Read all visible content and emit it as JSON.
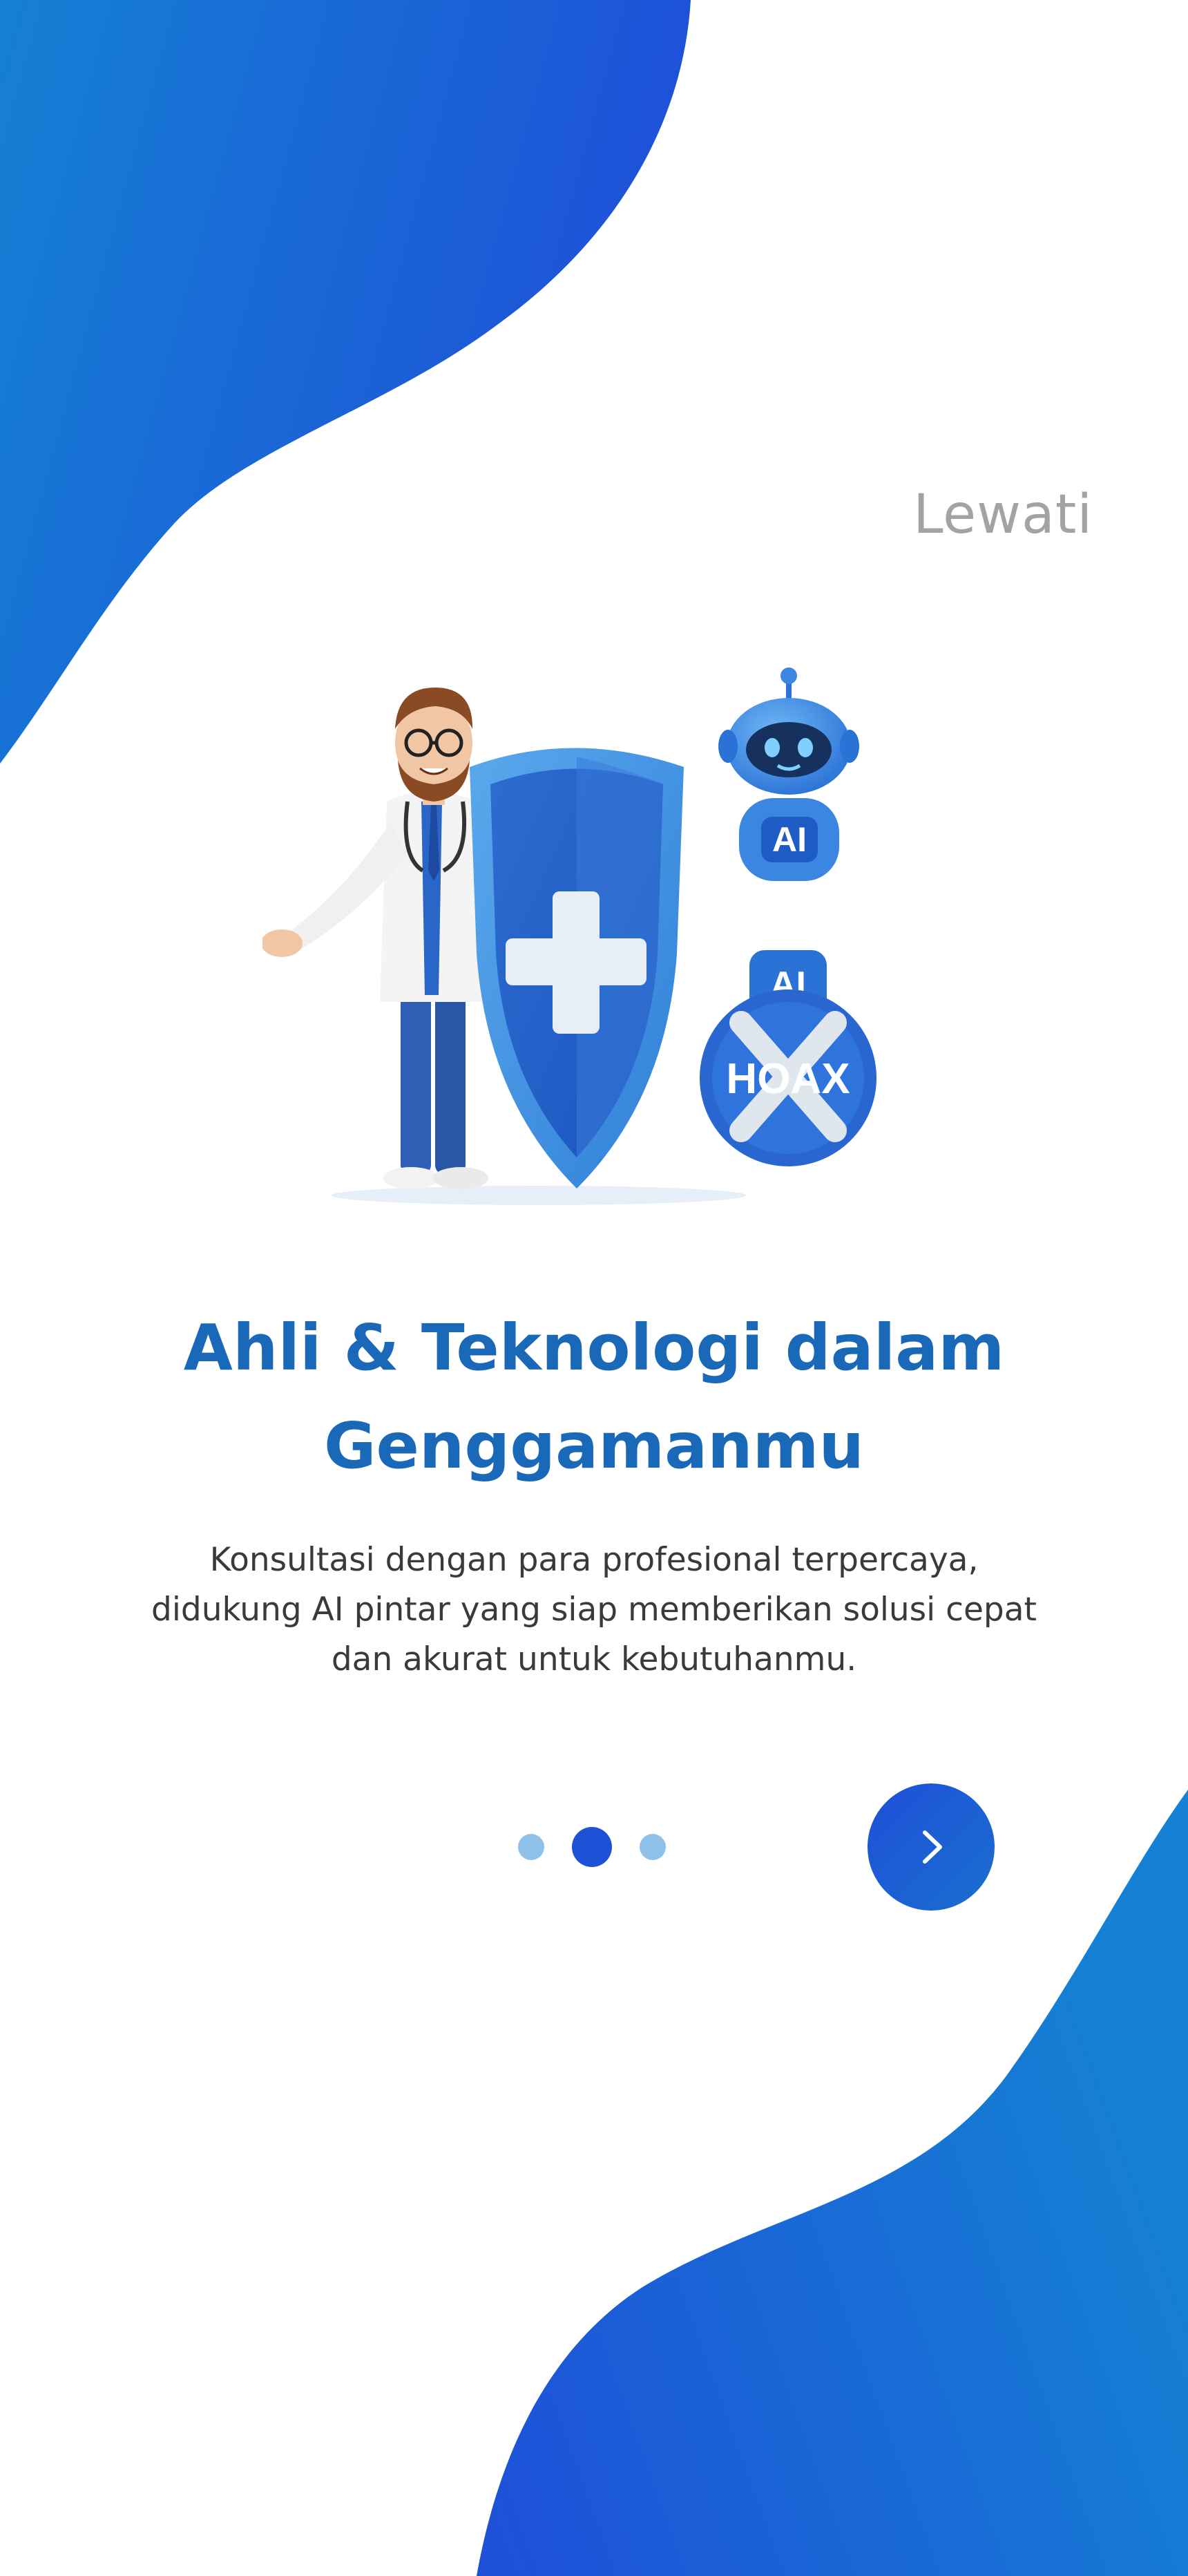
{
  "onboarding": {
    "skip_label": "Lewati",
    "title": "Ahli & Teknologi dalam Genggamanmu",
    "description": "Konsultasi dengan para profesional terpercaya, didukung AI pintar yang siap memberikan solusi cepat dan akurat untuk kebutuhanmu.",
    "pagination": {
      "total": 3,
      "current": 2
    },
    "next_icon": "chevron-right-icon",
    "illustration": {
      "ai_label_top": "AI",
      "ai_label_badge": "AI",
      "hoax_label": "HOAX"
    }
  },
  "colors": {
    "primary": "#1d51d6",
    "title": "#1a69b8",
    "skip": "#a3a3a3",
    "dot_inactive": "#8ec1ea",
    "blob_start": "#1580d4",
    "blob_end": "#1e4fd8"
  }
}
